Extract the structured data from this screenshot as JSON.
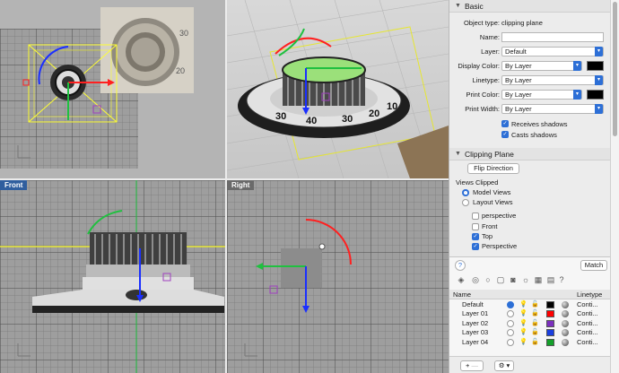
{
  "viewports": {
    "top": {
      "label": ""
    },
    "perspective": {
      "label": "",
      "dial_numbers": [
        "40",
        "30",
        "30",
        "20",
        "10"
      ]
    },
    "front": {
      "label": "Front"
    },
    "right": {
      "label": "Right"
    }
  },
  "properties": {
    "basic": {
      "title": "Basic",
      "object_type_label": "Object type:",
      "object_type_value": "clipping plane",
      "name_label": "Name:",
      "name_value": "",
      "layer_label": "Layer:",
      "layer_value": "Default",
      "display_color_label": "Display Color:",
      "display_color_value": "By Layer",
      "linetype_label": "Linetype:",
      "linetype_value": "By Layer",
      "print_color_label": "Print Color:",
      "print_color_value": "By Layer",
      "print_width_label": "Print Width:",
      "print_width_value": "By Layer",
      "receives_shadows": "Receives shadows",
      "casts_shadows": "Casts shadows"
    },
    "clipping": {
      "title": "Clipping Plane",
      "flip_button": "Flip Direction",
      "views_clipped": "Views Clipped",
      "model_views": "Model Views",
      "layout_views": "Layout Views",
      "views": [
        {
          "name": "perspective",
          "checked": false
        },
        {
          "name": "Front",
          "checked": false
        },
        {
          "name": "Top",
          "checked": true
        },
        {
          "name": "Perspective",
          "checked": true
        }
      ]
    },
    "help": "?",
    "match_button": "Match"
  },
  "layers": {
    "columns": {
      "name": "Name",
      "linetype": "Linetype"
    },
    "rows": [
      {
        "name": "Default",
        "current": true,
        "color": "#000000",
        "linetype": "Conti..."
      },
      {
        "name": "Layer 01",
        "current": false,
        "color": "#ff0000",
        "linetype": "Conti..."
      },
      {
        "name": "Layer 02",
        "current": false,
        "color": "#7b2fbe",
        "linetype": "Conti..."
      },
      {
        "name": "Layer 03",
        "current": false,
        "color": "#1a3fe0",
        "linetype": "Conti..."
      },
      {
        "name": "Layer 04",
        "current": false,
        "color": "#14a02a",
        "linetype": "Conti..."
      }
    ],
    "add_button": "+",
    "minus_button": "—",
    "gear_button": "⚙ ▾"
  }
}
